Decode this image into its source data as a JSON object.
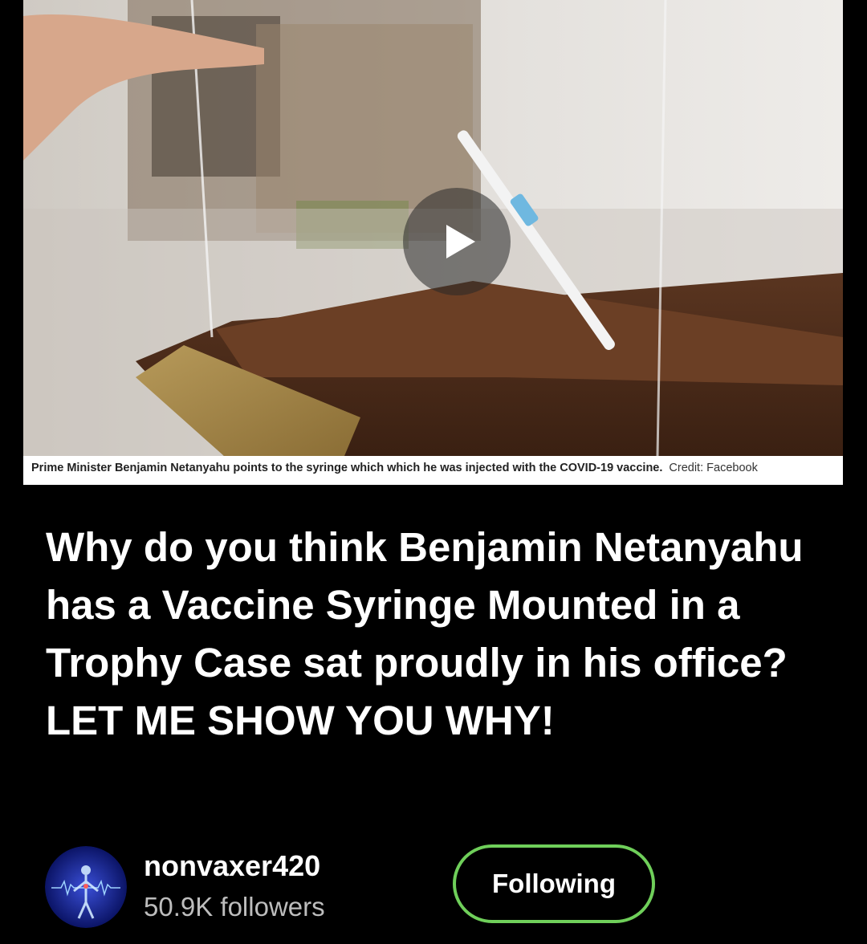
{
  "video": {
    "caption": "Prime Minister Benjamin Netanyahu points to the syringe which which he was injected with the COVID-19 vaccine.",
    "credit": "Credit: Facebook",
    "play_icon": "play-icon"
  },
  "post": {
    "title": "Why do you think Benjamin Netanyahu has a Vaccine Syringe Mounted in a Trophy Case sat proudly in his office? LET ME SHOW YOU WHY!"
  },
  "author": {
    "username": "nonvaxer420",
    "followers": "50.9K followers",
    "follow_label": "Following",
    "accent_color": "#6fcf5a"
  }
}
